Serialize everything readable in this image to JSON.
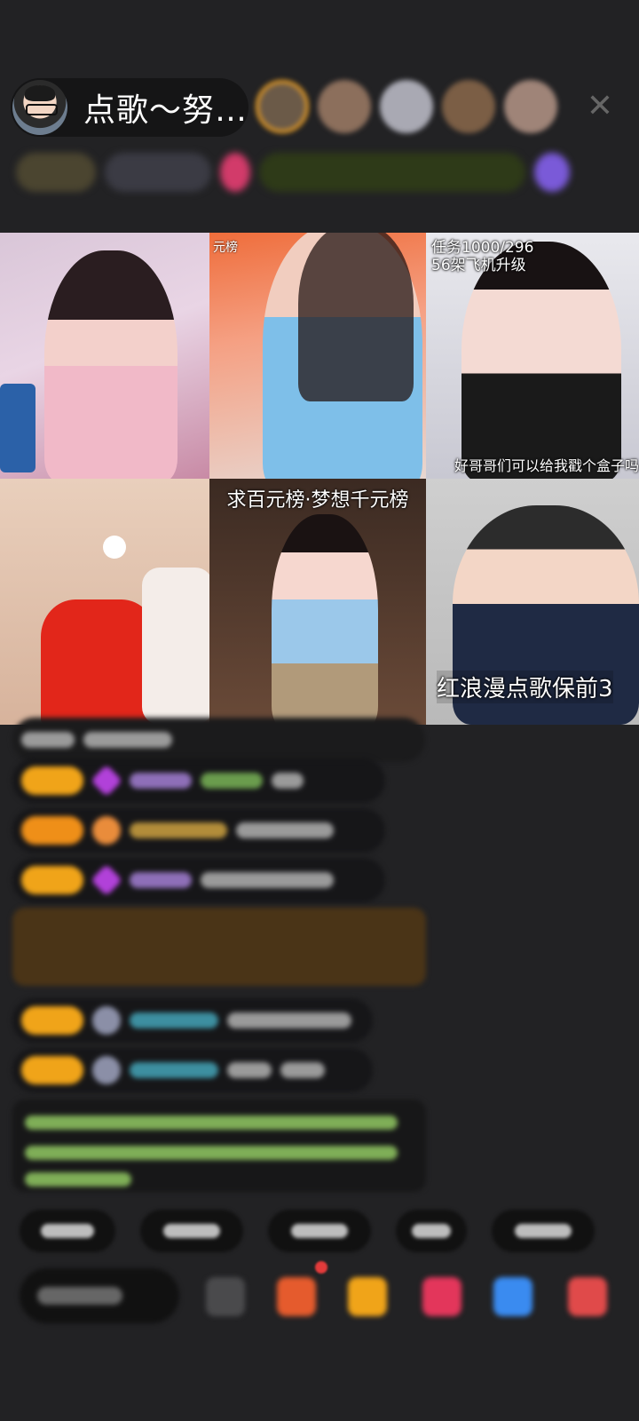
{
  "host": {
    "name": "点歌～努…",
    "avatar_icon": "host-avatar"
  },
  "header": {
    "close_icon": "close-icon"
  },
  "grid": {
    "tiles": [
      {
        "caption": ""
      },
      {
        "caption": ""
      },
      {
        "caption_top": "任务1000/296",
        "caption_second": "56架飞机升级",
        "caption_bottom": "好哥哥们可以给我戳个盒子吗"
      },
      {
        "caption": ""
      },
      {
        "caption_top": "求百元榜·梦想千元榜"
      },
      {
        "caption_bottom": "红浪漫点歌保前3"
      }
    ]
  },
  "colors": {
    "background": "#222224",
    "level_badge": "#f0a419",
    "gift_gem": "#b141d9",
    "chat_highlight": "#4a3417",
    "notice_text": "#8fbf5e"
  }
}
